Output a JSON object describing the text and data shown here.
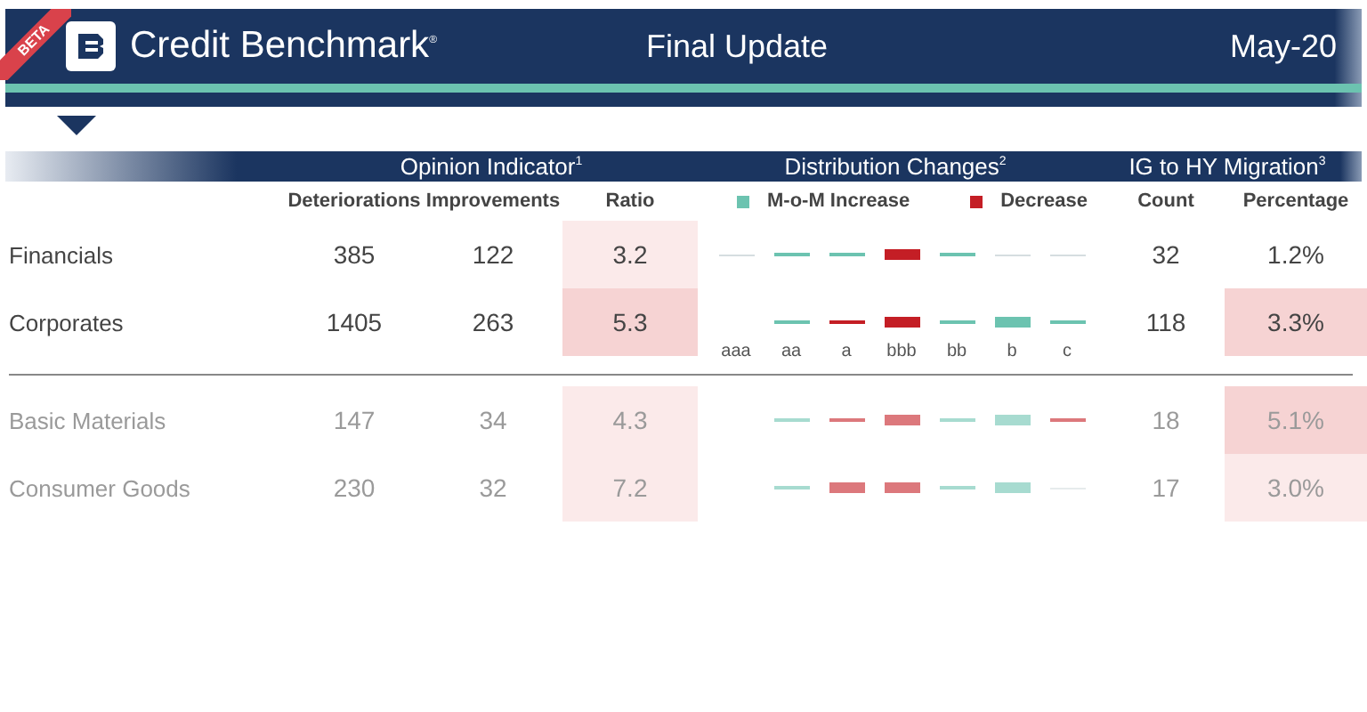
{
  "header": {
    "badge": "BETA",
    "brand": "Credit Benchmark$^{®}$",
    "title": "Final Update",
    "date": "May-20"
  },
  "sections": [
    {
      "label": "Opinion Indicator$^{1}$"
    },
    {
      "label": "Distribution Changes$^{2}$"
    },
    {
      "label": "IG to HY Migration$^{3}$"
    }
  ],
  "columns": {
    "deteriorations": "Deteriorations",
    "improvements": "Improvements",
    "ratio": "Ratio",
    "count": "Count",
    "percentage": "Percentage"
  },
  "legend": [
    {
      "label": "M-o-M Increase",
      "color": "#6cc3b0"
    },
    {
      "label": "Decrease",
      "color": "#c41e25"
    }
  ],
  "rating_labels": [
    "aaa",
    "aa",
    "a",
    "bbb",
    "bb",
    "b",
    "c"
  ],
  "summary_rows": [
    {
      "name": "Financials",
      "deteriorations": "385",
      "improvements": "122",
      "ratio": {
        "text": "3.2",
        "color": "#fbeaea"
      },
      "count": "32",
      "percentage": {
        "text": "1.2%"
      },
      "dimmed": false,
      "changes": [
        {
          "kind": "flat"
        },
        {
          "kind": "rise"
        },
        {
          "kind": "rise"
        },
        {
          "kind": "drop"
        },
        {
          "kind": "rise"
        },
        {
          "kind": "flat"
        },
        {
          "kind": "flat"
        }
      ]
    },
    {
      "name": "Corporates",
      "deteriorations": "1405",
      "improvements": "263",
      "ratio": {
        "text": "5.3",
        "color": "#f6d3d3"
      },
      "count": "118",
      "percentage": {
        "text": "3.3%",
        "color": "#f6d3d3"
      },
      "dimmed": false,
      "changes": [
        {
          "kind": "none"
        },
        {
          "kind": "rise"
        },
        {
          "kind": "dip"
        },
        {
          "kind": "drop"
        },
        {
          "kind": "rise"
        },
        {
          "kind": "surge"
        },
        {
          "kind": "rise"
        }
      ]
    }
  ],
  "sector_rows": [
    {
      "name": "Basic Materials",
      "deteriorations": "147",
      "improvements": "34",
      "ratio": {
        "text": "4.3",
        "color": "#fbeaea"
      },
      "count": "18",
      "percentage": {
        "text": "5.1%",
        "color": "#f6d3d3"
      },
      "dimmed": true,
      "changes": [
        {
          "kind": "none"
        },
        {
          "kind": "rise"
        },
        {
          "kind": "dip"
        },
        {
          "kind": "drop"
        },
        {
          "kind": "rise"
        },
        {
          "kind": "surge"
        },
        {
          "kind": "dip"
        }
      ]
    },
    {
      "name": "Consumer Goods",
      "deteriorations": "230",
      "improvements": "32",
      "ratio": {
        "text": "7.2",
        "color": "#fbeaea"
      },
      "count": "17",
      "percentage": {
        "text": "3.0%",
        "color": "#fbeaea"
      },
      "dimmed": true,
      "changes": [
        {
          "kind": "none"
        },
        {
          "kind": "rise"
        },
        {
          "kind": "drop"
        },
        {
          "kind": "drop"
        },
        {
          "kind": "rise"
        },
        {
          "kind": "surge"
        },
        {
          "kind": "flat"
        }
      ]
    }
  ]
}
